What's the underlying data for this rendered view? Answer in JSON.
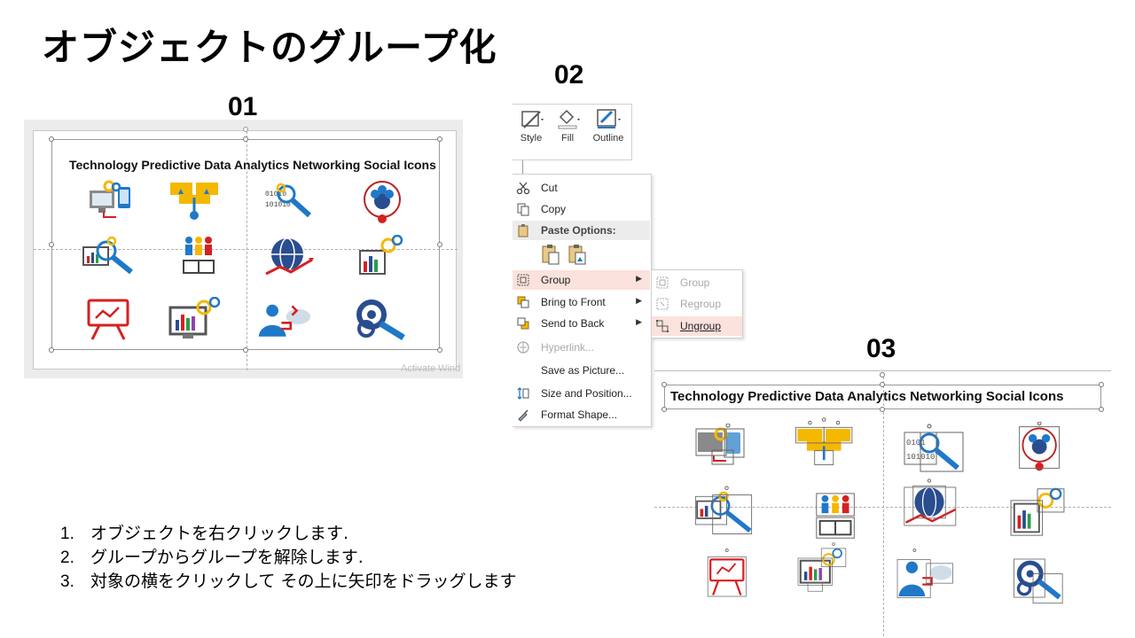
{
  "page_title": "オブジェクトのグループ化",
  "step_labels": {
    "s1": "01",
    "s2": "02",
    "s3": "03"
  },
  "panel1": {
    "slide_title": "Technology Predictive Data Analytics Networking Social Icons",
    "watermark": "Activate Wind",
    "icons": [
      "monitor-tablet-gears-icon",
      "flowchart-icon",
      "binary-magnifier-icon",
      "team-circle-icon",
      "chart-magnifier-icon",
      "people-book-icon",
      "globe-network-icon",
      "chart-gears-icon",
      "presentation-board-icon",
      "monitor-gears-icon",
      "businessman-cloud-icon",
      "gears-magnifier-icon"
    ]
  },
  "ribbon": {
    "style": "Style",
    "fill": "Fill",
    "outline": "Outline"
  },
  "context_menu": {
    "cut": "Cut",
    "copy": "Copy",
    "paste_options": "Paste Options:",
    "group": "Group",
    "bring_to_front": "Bring to Front",
    "send_to_back": "Send to Back",
    "hyperlink": "Hyperlink...",
    "save_as_picture": "Save as Picture...",
    "size_and_position": "Size and Position...",
    "format_shape": "Format Shape..."
  },
  "submenu": {
    "group": "Group",
    "regroup": "Regroup",
    "ungroup": "Ungroup"
  },
  "panel3": {
    "slide_title": "Technology Predictive Data Analytics Networking Social Icons"
  },
  "instructions": [
    {
      "num": "1.",
      "text": "オブジェクトを右クリックします."
    },
    {
      "num": "2.",
      "text": "グループからグループを解除します."
    },
    {
      "num": "3.",
      "text": "対象の横をクリックして その上に矢印をドラッグします"
    }
  ],
  "colors": {
    "accent_blue": "#1f78c8",
    "accent_yellow": "#f5b800",
    "accent_red": "#d62020",
    "menu_highlight": "#fbe2dc"
  }
}
